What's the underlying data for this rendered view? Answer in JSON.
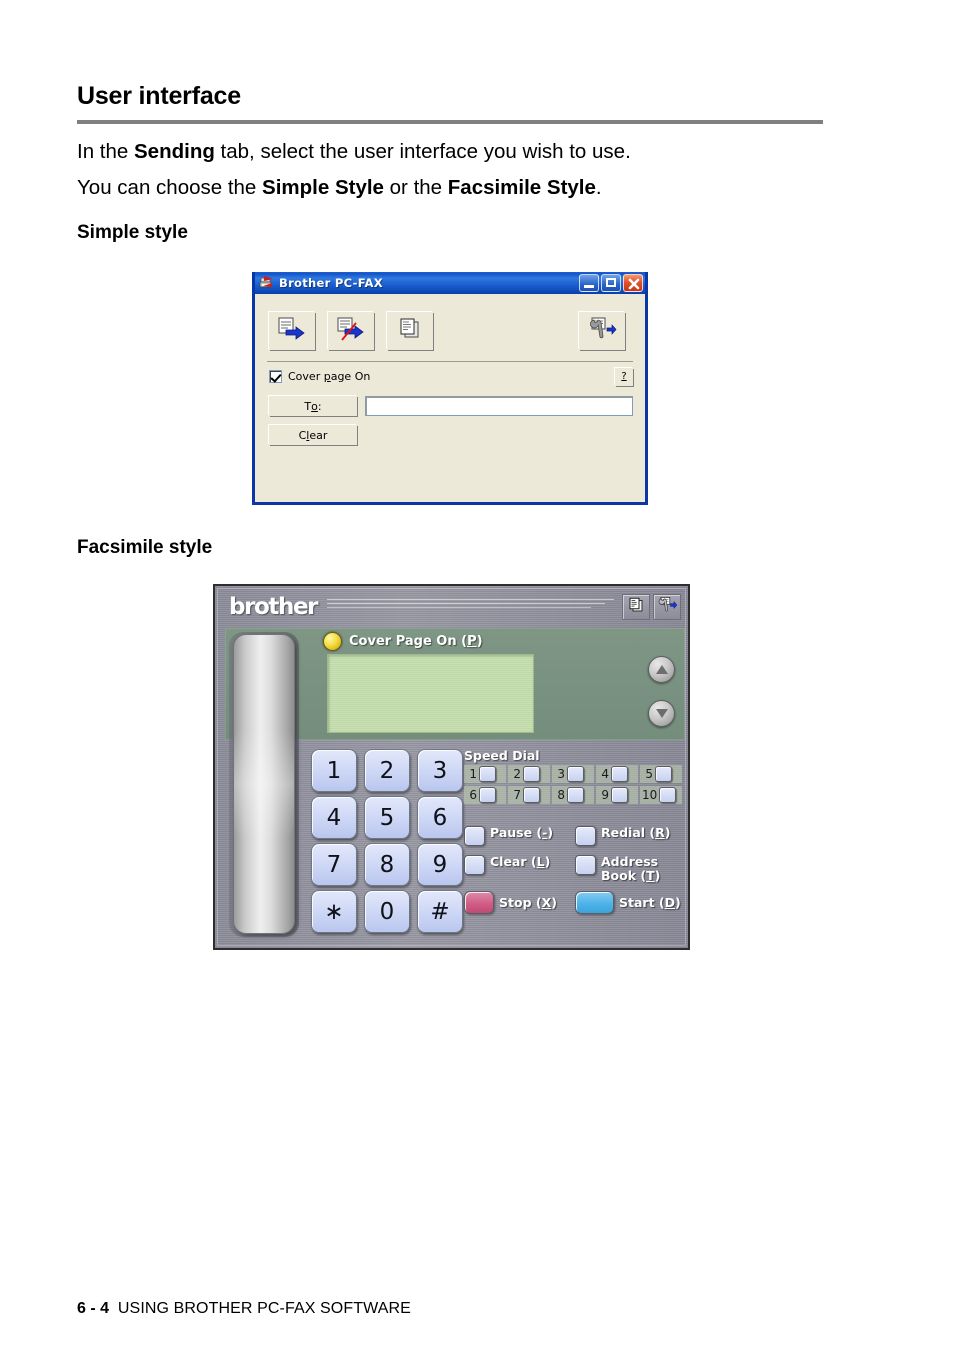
{
  "page": {
    "title": "User interface",
    "paragraph_1_pre": "In the ",
    "paragraph_1_bold": "Sending",
    "paragraph_1_post": " tab, select the user interface you wish to use.",
    "paragraph_2_pre": "You can choose the ",
    "paragraph_2_bold_1": "Simple Style",
    "paragraph_2_mid": " or the ",
    "paragraph_2_bold_2": "Facsimile Style",
    "paragraph_2_post": ".",
    "subhead_simple": "Simple style",
    "subhead_facsimile": "Facsimile style",
    "footer_page": "6 - 4",
    "footer_text": "USING BROTHER PC-FAX SOFTWARE"
  },
  "simple_dialog": {
    "title": "Brother PC-FAX",
    "title_icon": "brother-pcfax-icon",
    "window_buttons": [
      {
        "name": "minimize-button",
        "icon": "minimize-icon"
      },
      {
        "name": "maximize-button",
        "icon": "maximize-icon"
      },
      {
        "name": "close-button",
        "icon": "close-icon"
      }
    ],
    "toolbar": [
      {
        "name": "send-fax-button",
        "icon": "document-arrow-right-icon"
      },
      {
        "name": "send-fax-no-cover-button",
        "icon": "document-arrow-slash-icon"
      },
      {
        "name": "cover-page-button",
        "icon": "copy-pages-icon"
      },
      {
        "name": "address-book-setup-button",
        "icon": "wrench-arrow-icon"
      }
    ],
    "cover_page_label_pre": "Cover ",
    "cover_page_label_key": "p",
    "cover_page_label_post": "age On",
    "cover_page_checked": true,
    "help_label": "?",
    "to_button_pre": "T",
    "to_button_key": "o",
    "to_button_post": ":",
    "clear_button_pre": "C",
    "clear_button_key": "l",
    "clear_button_post": "ear",
    "to_field_value": "",
    "to_field_placeholder": "",
    "colors": {
      "titlebar": "#0b36a8",
      "face": "#ece9d8",
      "close": "#e2522a"
    }
  },
  "fax_panel": {
    "logo": "brother",
    "header_icons": [
      {
        "name": "cover-page-icon",
        "icon": "copy-pages-icon"
      },
      {
        "name": "setup-icon",
        "icon": "wrench-arrow-icon"
      }
    ],
    "cover_page_label_pre": "Cover Page On (",
    "cover_page_key": "P",
    "cover_page_label_post": ")",
    "lcd_value": "",
    "nav_up": "scroll-up",
    "nav_down": "scroll-down",
    "keypad": [
      "1",
      "2",
      "3",
      "4",
      "5",
      "6",
      "7",
      "8",
      "9",
      "∗",
      "0",
      "#"
    ],
    "speed_dial_title": "Speed Dial",
    "speed_dial_numbers": [
      "1",
      "2",
      "3",
      "4",
      "5",
      "6",
      "7",
      "8",
      "9",
      "10"
    ],
    "functions": [
      {
        "name": "pause-button",
        "pre": "Pause (",
        "key": "-",
        "post": ")"
      },
      {
        "name": "redial-button",
        "pre": "Redial (",
        "key": "R",
        "post": ")"
      },
      {
        "name": "clear-button",
        "pre": "Clear (",
        "key": "L",
        "post": ")"
      },
      {
        "name": "address-book-button",
        "pre": "Address Book (",
        "key": "T",
        "post": ")"
      },
      {
        "name": "stop-button",
        "pre": "Stop (",
        "key": "X",
        "post": ")"
      },
      {
        "name": "start-button",
        "pre": "Start (",
        "key": "D",
        "post": ")"
      }
    ],
    "colors": {
      "lcd": "#c3ddab",
      "keys": "#ccd6f5",
      "stop": "#cf5a83",
      "start": "#4fb3e8",
      "led": "#f5df4a"
    }
  }
}
